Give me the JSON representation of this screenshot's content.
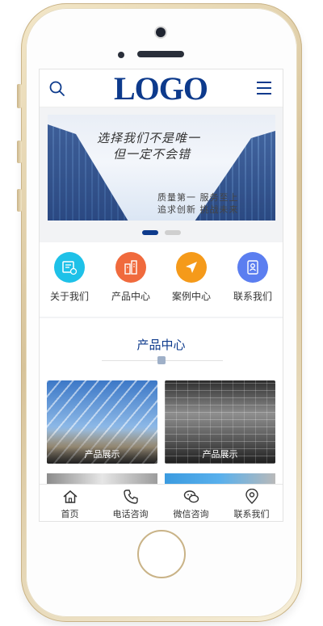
{
  "header": {
    "logo_text": "LOGO"
  },
  "banner": {
    "headline_1": "选择我们不是唯一",
    "headline_2": "但一定不会错",
    "sub_1": "质量第一  服务至上",
    "sub_2": "追求创新  挑战未来"
  },
  "quick_nav": [
    {
      "label": "关于我们",
      "icon": "about-icon",
      "color": "#1ec1e8"
    },
    {
      "label": "产品中心",
      "icon": "product-icon",
      "color": "#f06a3d"
    },
    {
      "label": "案例中心",
      "icon": "case-icon",
      "color": "#f59a1a"
    },
    {
      "label": "联系我们",
      "icon": "contact-icon",
      "color": "#5b7ef0"
    }
  ],
  "products": {
    "title": "产品中心",
    "items": [
      {
        "caption": "产品展示"
      },
      {
        "caption": "产品展示"
      }
    ]
  },
  "bottom_nav": [
    {
      "label": "首页",
      "icon": "home-icon"
    },
    {
      "label": "电话咨询",
      "icon": "phone-icon"
    },
    {
      "label": "微信咨询",
      "icon": "wechat-icon"
    },
    {
      "label": "联系我们",
      "icon": "location-icon"
    }
  ],
  "colors": {
    "brand": "#0d3a8c",
    "frame_gold": "#d7c39a"
  }
}
